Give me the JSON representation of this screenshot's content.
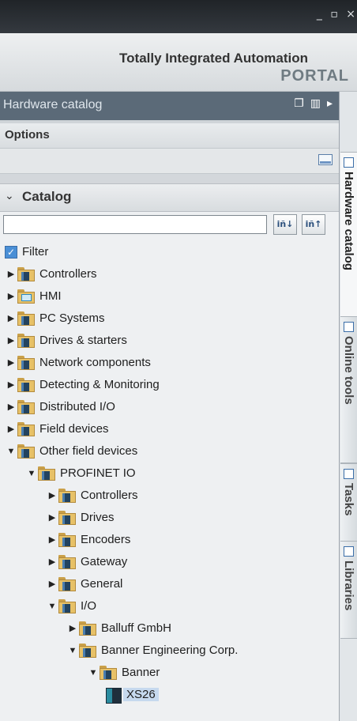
{
  "window": {
    "controls": [
      "_",
      "▫",
      "×"
    ]
  },
  "portal": {
    "line1": "Totally Integrated Automation",
    "line2": "PORTAL"
  },
  "hardware_catalog": {
    "title": "Hardware catalog"
  },
  "options": {
    "title": "Options"
  },
  "catalog": {
    "title": "Catalog",
    "search_value": "",
    "search_placeholder": ""
  },
  "filter": {
    "label": "Filter",
    "checked": true
  },
  "tree": [
    {
      "label": "Controllers",
      "level": 0,
      "expanded": false,
      "icon": "folder-device"
    },
    {
      "label": "HMI",
      "level": 0,
      "expanded": false,
      "icon": "folder-hmi"
    },
    {
      "label": "PC Systems",
      "level": 0,
      "expanded": false,
      "icon": "folder-device"
    },
    {
      "label": "Drives & starters",
      "level": 0,
      "expanded": false,
      "icon": "folder-device"
    },
    {
      "label": "Network components",
      "level": 0,
      "expanded": false,
      "icon": "folder-device"
    },
    {
      "label": "Detecting & Monitoring",
      "level": 0,
      "expanded": false,
      "icon": "folder-device"
    },
    {
      "label": "Distributed I/O",
      "level": 0,
      "expanded": false,
      "icon": "folder-device"
    },
    {
      "label": "Field devices",
      "level": 0,
      "expanded": false,
      "icon": "folder-device"
    },
    {
      "label": "Other field devices",
      "level": 0,
      "expanded": true,
      "icon": "folder-device"
    },
    {
      "label": "PROFINET IO",
      "level": 1,
      "expanded": true,
      "icon": "folder-device"
    },
    {
      "label": "Controllers",
      "level": 2,
      "expanded": false,
      "icon": "folder-device"
    },
    {
      "label": "Drives",
      "level": 2,
      "expanded": false,
      "icon": "folder-device"
    },
    {
      "label": "Encoders",
      "level": 2,
      "expanded": false,
      "icon": "folder-device"
    },
    {
      "label": "Gateway",
      "level": 2,
      "expanded": false,
      "icon": "folder-device"
    },
    {
      "label": "General",
      "level": 2,
      "expanded": false,
      "icon": "folder-device"
    },
    {
      "label": "I/O",
      "level": 2,
      "expanded": true,
      "icon": "folder-device"
    },
    {
      "label": "Balluff GmbH",
      "level": 3,
      "expanded": false,
      "icon": "folder-device"
    },
    {
      "label": "Banner Engineering Corp.",
      "level": 3,
      "expanded": true,
      "icon": "folder-device"
    },
    {
      "label": "Banner",
      "level": 4,
      "expanded": true,
      "icon": "folder-device"
    },
    {
      "label": "XS26",
      "level": 5,
      "expanded": null,
      "icon": "module",
      "selected": true
    }
  ],
  "side_tabs": [
    "Hardware catalog",
    "Online tools",
    "Tasks",
    "Libraries"
  ]
}
